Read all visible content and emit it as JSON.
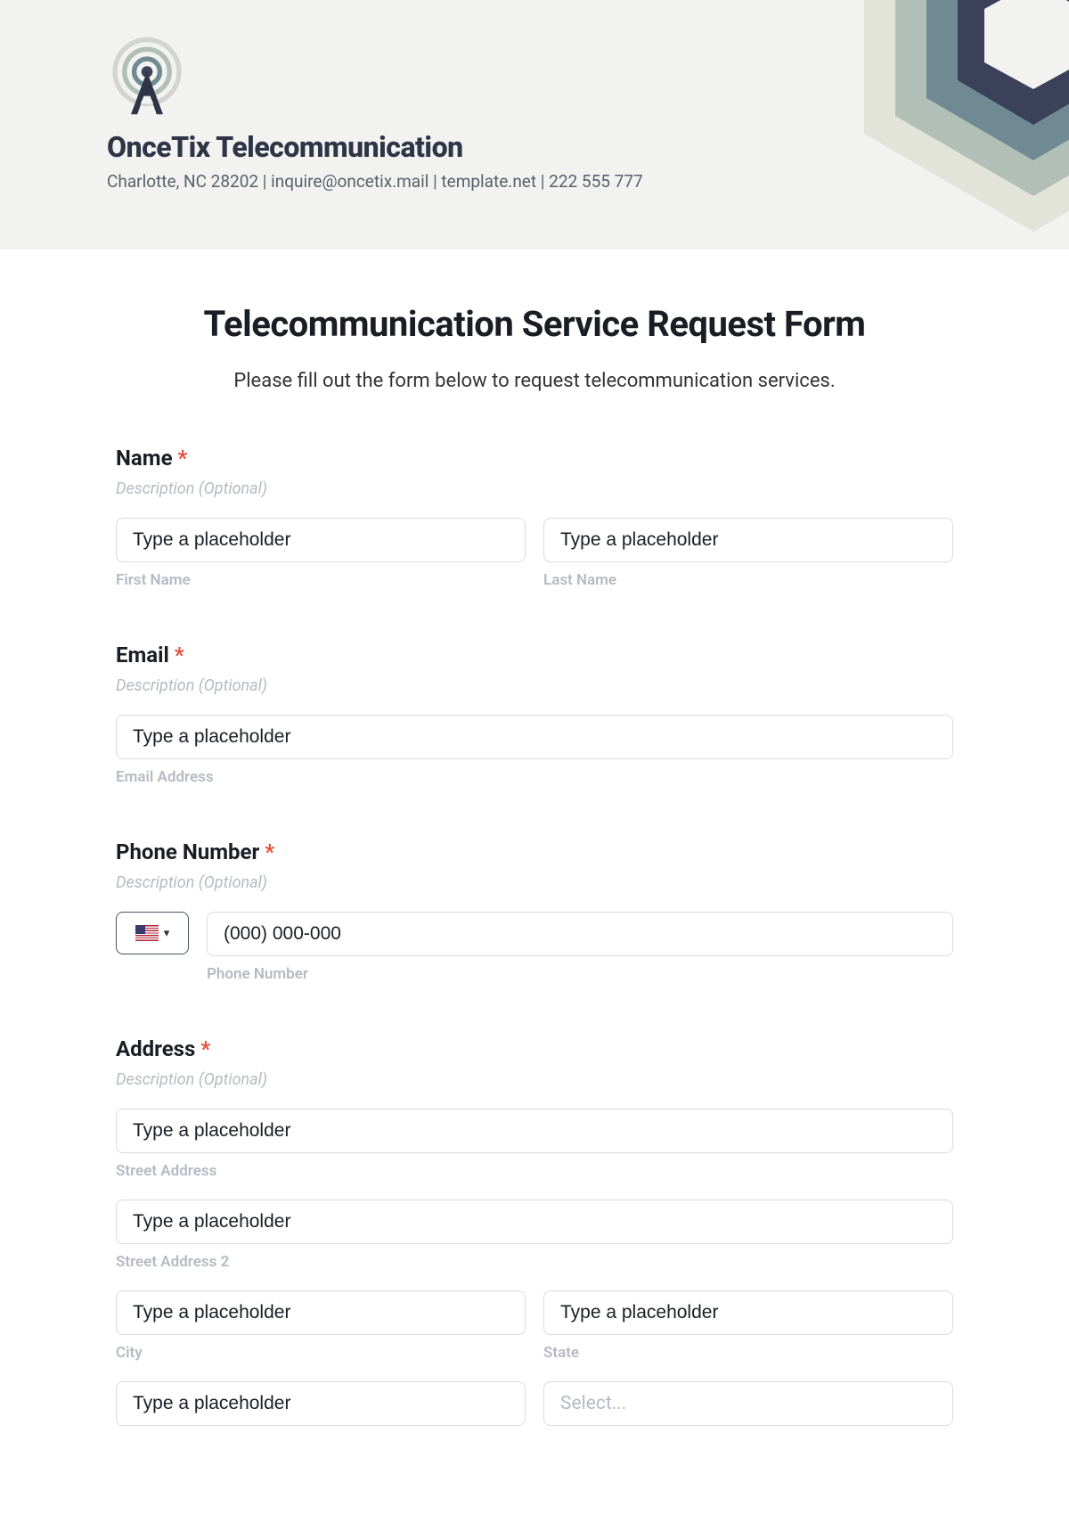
{
  "header": {
    "company_name": "OnceTix Telecommunication",
    "company_line": "Charlotte, NC 28202 | inquire@oncetix.mail | template.net | 222 555 777"
  },
  "form": {
    "title": "Telecommunication Service Request Form",
    "subtitle": "Please fill out the form below to request telecommunication services.",
    "desc_optional": "Description (Optional)",
    "placeholder_generic": "Type a placeholder",
    "name": {
      "label": "Name",
      "first_sub": "First Name",
      "last_sub": "Last Name"
    },
    "email": {
      "label": "Email",
      "sub": "Email Address"
    },
    "phone": {
      "label": "Phone Number",
      "placeholder": "(000) 000-000",
      "sub": "Phone Number"
    },
    "address": {
      "label": "Address",
      "street_sub": "Street Address",
      "street2_sub": "Street Address 2",
      "city_sub": "City",
      "state_sub": "State",
      "country_placeholder": "Select..."
    },
    "required_mark": "*"
  },
  "colors": {
    "navy": "#3a4158",
    "teal": "#6f8a93",
    "sage": "#b2bfb7",
    "cream": "#e2e3d9"
  }
}
